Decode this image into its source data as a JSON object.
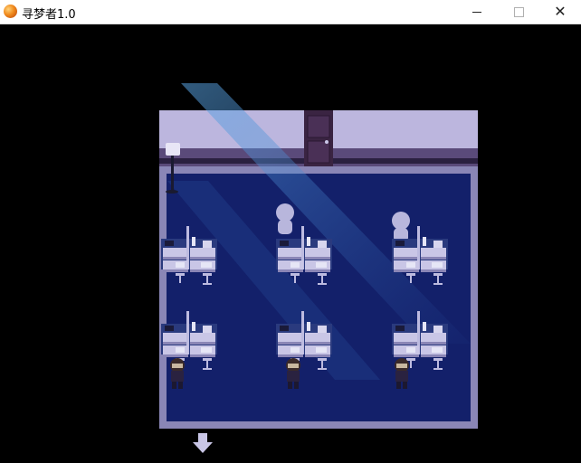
{
  "window": {
    "title": "寻梦者1.0",
    "app_icon": "orange-orb-icon",
    "controls": {
      "minimize": "minimize-icon",
      "maximize": "maximize-icon",
      "close": "close-icon"
    }
  },
  "scene": {
    "type": "classroom-night",
    "colors": {
      "wall": "#bcb6de",
      "floor": "#13206a",
      "floor_border": "#8a86b6",
      "door": "#3a2442",
      "light_beam": "#4a8fd0"
    },
    "desk_groups": 6,
    "students": 3,
    "exit_arrow": "down-arrow-icon"
  }
}
